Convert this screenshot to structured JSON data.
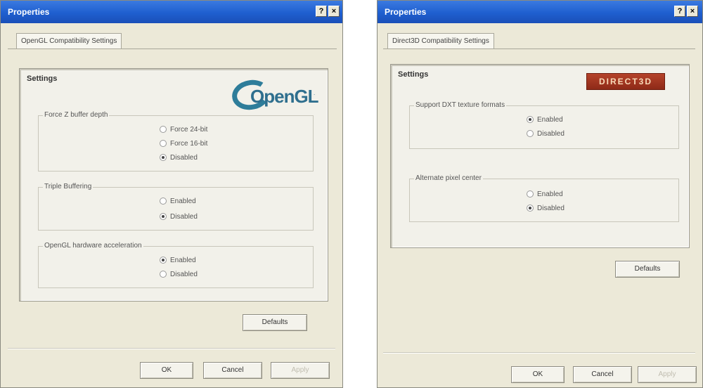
{
  "dialogs": [
    {
      "title": "Properties",
      "help_glyph": "?",
      "close_glyph": "×",
      "tab_label": "OpenGL Compatibility Settings",
      "panel_title": "Settings",
      "logo_text": "OpenGL",
      "logo_mark": ".",
      "groups": [
        {
          "label": "Force Z buffer depth",
          "options": [
            {
              "label": "Force 24-bit",
              "selected": false
            },
            {
              "label": "Force 16-bit",
              "selected": false
            },
            {
              "label": "Disabled",
              "selected": true
            }
          ]
        },
        {
          "label": "Triple Buffering",
          "options": [
            {
              "label": "Enabled",
              "selected": false
            },
            {
              "label": "Disabled",
              "selected": true
            }
          ]
        },
        {
          "label": "OpenGL hardware acceleration",
          "options": [
            {
              "label": "Enabled",
              "selected": true
            },
            {
              "label": "Disabled",
              "selected": false
            }
          ]
        }
      ],
      "defaults_label": "Defaults",
      "ok_label": "OK",
      "cancel_label": "Cancel",
      "apply_label": "Apply"
    },
    {
      "title": "Properties",
      "help_glyph": "?",
      "close_glyph": "×",
      "tab_label": "Direct3D Compatibility Settings",
      "panel_title": "Settings",
      "logo_text": "DIRECT3D",
      "groups": [
        {
          "label": "Support DXT texture formats",
          "options": [
            {
              "label": "Enabled",
              "selected": true
            },
            {
              "label": "Disabled",
              "selected": false
            }
          ]
        },
        {
          "label": "Alternate pixel center",
          "options": [
            {
              "label": "Enabled",
              "selected": false
            },
            {
              "label": "Disabled",
              "selected": true
            }
          ]
        }
      ],
      "defaults_label": "Defaults",
      "ok_label": "OK",
      "cancel_label": "Cancel",
      "apply_label": "Apply"
    }
  ]
}
